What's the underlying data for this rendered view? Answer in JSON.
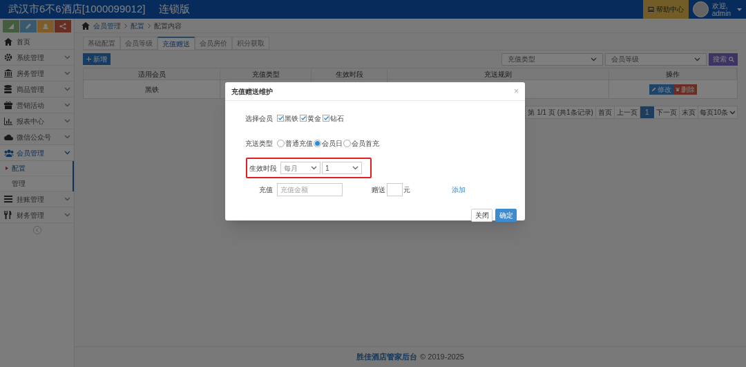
{
  "header": {
    "title": "武汉市6不6酒店[1000099012]",
    "edition": "连锁版",
    "help": "帮助中心",
    "greeting": "欢迎,",
    "user": "admin"
  },
  "sidebar": {
    "items": [
      {
        "label": "首页",
        "expandable": false,
        "expanded": false
      },
      {
        "label": "系统管理",
        "expandable": true,
        "expanded": false
      },
      {
        "label": "房务管理",
        "expandable": true,
        "expanded": false
      },
      {
        "label": "商品管理",
        "expandable": true,
        "expanded": false
      },
      {
        "label": "营销活动",
        "expandable": true,
        "expanded": false
      },
      {
        "label": "报表中心",
        "expandable": true,
        "expanded": false
      },
      {
        "label": "微信公众号",
        "expandable": true,
        "expanded": false
      },
      {
        "label": "会员管理",
        "expandable": true,
        "expanded": true,
        "children": [
          {
            "label": "配置",
            "selected": true
          },
          {
            "label": "管理",
            "selected": false
          }
        ]
      },
      {
        "label": "挂账管理",
        "expandable": true,
        "expanded": false
      },
      {
        "label": "财务管理",
        "expandable": true,
        "expanded": false
      }
    ]
  },
  "breadcrumb": [
    "会员管理",
    "配置",
    "配置内容"
  ],
  "tabs": [
    {
      "label": "基础配置",
      "selected": false
    },
    {
      "label": "会员等级",
      "selected": false
    },
    {
      "label": "充值赠送",
      "selected": true
    },
    {
      "label": "会员房价",
      "selected": false
    },
    {
      "label": "积分获取",
      "selected": false
    }
  ],
  "new_button": "新增",
  "filters": [
    {
      "placeholder": "充值类型"
    },
    {
      "placeholder": "会员等级"
    }
  ],
  "search_button": "搜索",
  "table": {
    "columns": [
      "适用会员",
      "充值类型",
      "生效时段",
      "充送规则",
      "操作"
    ],
    "rows": [
      {
        "member": "黑铁",
        "edit": "修改",
        "delete": "删除"
      }
    ]
  },
  "pagination": {
    "info": "第 1/1 页 (共1条记录)",
    "first": "首页",
    "prev": "上一页",
    "current": "1",
    "next": "下一页",
    "last": "末页",
    "page_size": "每页10条"
  },
  "footer": {
    "brand": "胜佳酒店管家后台",
    "copyright": "© 2019-2025"
  },
  "dialog": {
    "title": "充值赠送维护",
    "close": "×",
    "member_label": "选择会员",
    "members": [
      {
        "label": "黑铁",
        "checked": true
      },
      {
        "label": "黄金",
        "checked": true
      },
      {
        "label": "钻石",
        "checked": true
      }
    ],
    "type_label": "充送类型",
    "types": [
      {
        "label": "普通充值",
        "selected": false
      },
      {
        "label": "会员日",
        "selected": true
      },
      {
        "label": "会员首充",
        "selected": false
      }
    ],
    "period_label": "生效时段",
    "period": [
      "每月",
      "1"
    ],
    "amount_label": "充值",
    "amount_placeholder": "充值金额",
    "gift_label": "赠送",
    "unit": "元",
    "add_link": "添加",
    "buttons": [
      "关闭",
      "确定"
    ]
  }
}
